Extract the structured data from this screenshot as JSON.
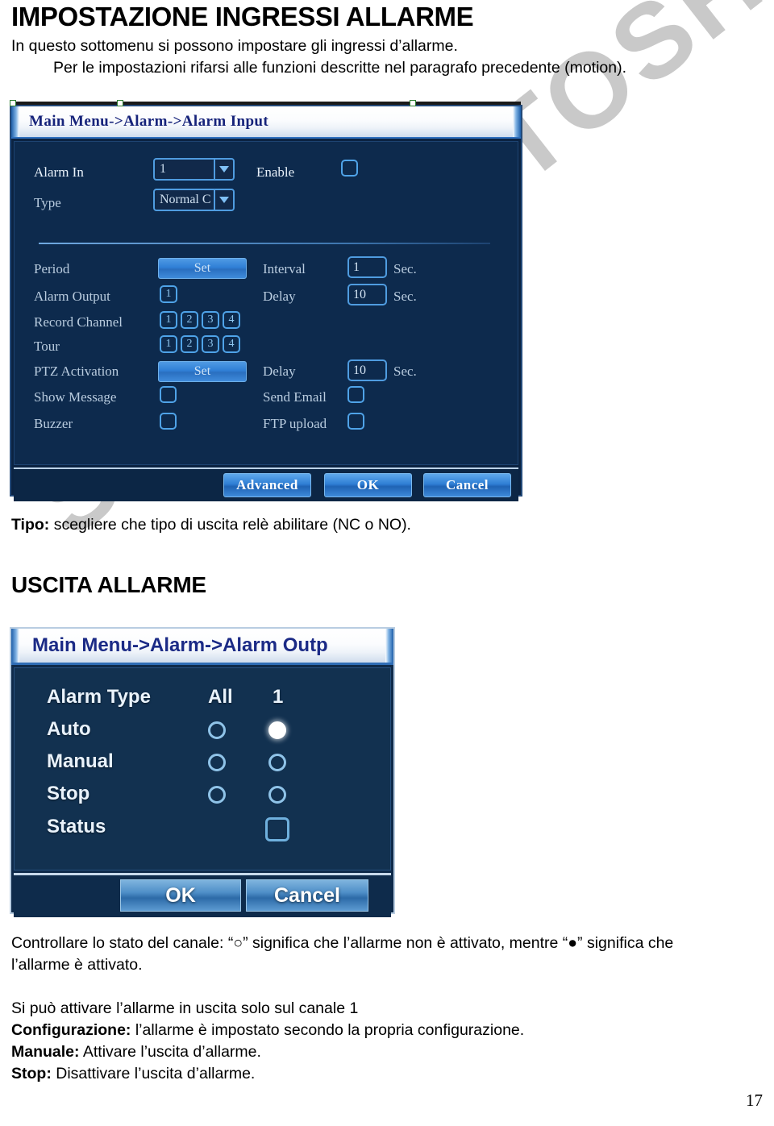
{
  "document": {
    "page_title": "IMPOSTAZIONE INGRESSI ALLARME",
    "intro_line1": "In questo sottomenu si possono impostare gli ingressi d’allarme.",
    "intro_line2": "Per le impostazioni rifarsi alle funzioni descritte nel paragrafo precedente (motion).",
    "mid_note_bold": "Tipo:",
    "mid_note_rest": " scegliere che tipo di uscita relè abilitare (NC o NO).",
    "section_title": "USCITA ALLARME",
    "tail_line1": "Controllare lo stato del canale: “○” significa che l’allarme non è attivato, mentre “●” significa che",
    "tail_line2": "l’allarme è attivato.",
    "tail_line3": "Si può attivare l’allarme in uscita solo sul canale 1",
    "tail_line4_bold": "Configurazione:",
    "tail_line4_rest": " l’allarme è impostato secondo la propria configurazione.",
    "tail_line5_bold": "Manuale:",
    "tail_line5_rest": " Attivare l’uscita d’allarme.",
    "tail_line6_bold": "Stop:",
    "tail_line6_rest": " Disattivare l’uscita d’allarme.",
    "page_number": "17",
    "watermark": "SICURTUTTOSHOP.IT"
  },
  "alarm_input_dialog": {
    "title": "Main Menu->Alarm->Alarm Input",
    "labels": {
      "alarm_in": "Alarm In",
      "enable": "Enable",
      "type": "Type",
      "period": "Period",
      "interval": "Interval",
      "alarm_output": "Alarm Output",
      "delay": "Delay",
      "record_channel": "Record Channel",
      "tour": "Tour",
      "ptz_activation": "PTZ Activation",
      "ptz_delay": "Delay",
      "show_message": "Show Message",
      "send_email": "Send Email",
      "buzzer": "Buzzer",
      "ftp_upload": "FTP upload"
    },
    "values": {
      "alarm_in": "1",
      "type": "Normal C",
      "interval": "1",
      "interval_unit": "Sec.",
      "alarm_output": "1",
      "delay": "10",
      "delay_unit": "Sec.",
      "ptz_delay": "10",
      "ptz_delay_unit": "Sec.",
      "record_channels": [
        "1",
        "2",
        "3",
        "4"
      ],
      "tour_channels": [
        "1",
        "2",
        "3",
        "4"
      ],
      "period_button": "Set",
      "ptz_button": "Set"
    },
    "buttons": {
      "advanced": "Advanced",
      "ok": "OK",
      "cancel": "Cancel"
    }
  },
  "alarm_output_dialog": {
    "title": "Main Menu->Alarm->Alarm Outp",
    "rows": [
      {
        "label": "Alarm Type",
        "all": "All",
        "ch1": "1",
        "kind": "header"
      },
      {
        "label": "Auto",
        "all": "off",
        "ch1": "on",
        "kind": "radio"
      },
      {
        "label": "Manual",
        "all": "off",
        "ch1": "off",
        "kind": "radio"
      },
      {
        "label": "Stop",
        "all": "off",
        "ch1": "off",
        "kind": "radio"
      },
      {
        "label": "Status",
        "all": "",
        "ch1": "box",
        "kind": "checkbox"
      }
    ],
    "buttons": {
      "ok": "OK",
      "cancel": "Cancel"
    }
  }
}
